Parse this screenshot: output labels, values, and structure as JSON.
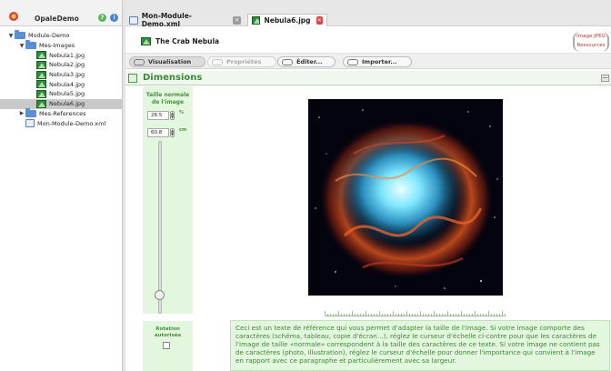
{
  "app": {
    "name": "OpaleDemo",
    "help_glyph": "?",
    "info_glyph": "i"
  },
  "tree": {
    "items": [
      {
        "label": "Module-Demo",
        "type": "folder",
        "expanded": true
      },
      {
        "label": "Mes-Images",
        "type": "folder",
        "expanded": true
      },
      {
        "label": "Nebula1.jpg",
        "type": "image"
      },
      {
        "label": "Nebula2.jpg",
        "type": "image"
      },
      {
        "label": "Nebula3.jpg",
        "type": "image"
      },
      {
        "label": "Nebula4.jpg",
        "type": "image"
      },
      {
        "label": "Nebula5.jpg",
        "type": "image"
      },
      {
        "label": "Nebula6.jpg",
        "type": "image",
        "selected": true
      },
      {
        "label": "Mes-References",
        "type": "folder",
        "expanded": false
      },
      {
        "label": "Mon-Module-Demo.xml",
        "type": "xml"
      }
    ],
    "arrow_expanded": "▼",
    "arrow_collapsed": "▶"
  },
  "tabs": [
    {
      "label": "Mon-Module-Demo.xml",
      "active": false,
      "icon": "xml-file-icon"
    },
    {
      "label": "Nebula6.jpg",
      "active": true,
      "icon": "image-file-icon"
    }
  ],
  "tab_close_glyph": "✕",
  "document": {
    "title": "The Crab Nebula",
    "meta_line1": "Image JPEG",
    "meta_line2": "Ressources"
  },
  "toolbar": {
    "buttons": [
      {
        "label": "Visualisation",
        "state": "active"
      },
      {
        "label": "Propriétés",
        "state": "disabled"
      },
      {
        "label": "Éditer...",
        "state": "normal"
      },
      {
        "label": "Importer...",
        "state": "normal"
      }
    ]
  },
  "section": {
    "title": "Dimensions",
    "collapse_glyph": "—"
  },
  "dimensions": {
    "label": "Taille normale de l'image",
    "percent_value": "28.5",
    "percent_unit": "%",
    "cm_value": "60.8",
    "cm_unit": "cm",
    "spin_up": "▲",
    "spin_down": "▼",
    "rotation_label": "Rotation autorisée",
    "rotation_allowed": false
  },
  "reference_text": "Ceci est un texte de référence qui vous permet d'adapter la taille de l'image. Si votre image comporte des caractères (schéma, tableau, copie d'écran...), réglez le curseur d'échelle ci-contre pour que les caractères de l'image de taille «normale» correspondent à la taille des caractères de ce texte. Si votre image ne contient pas de caractères (photo, illustration), réglez le curseur d'échelle pour donner l'importance qui convient à l'image en rapport avec ce paragraphe et particulièrement avec sa largeur.",
  "colors": {
    "accent_green": "#3b8a36",
    "panel_green": "#e3f6de",
    "close_red": "#e04343",
    "folder_blue": "#5a8fd6"
  }
}
